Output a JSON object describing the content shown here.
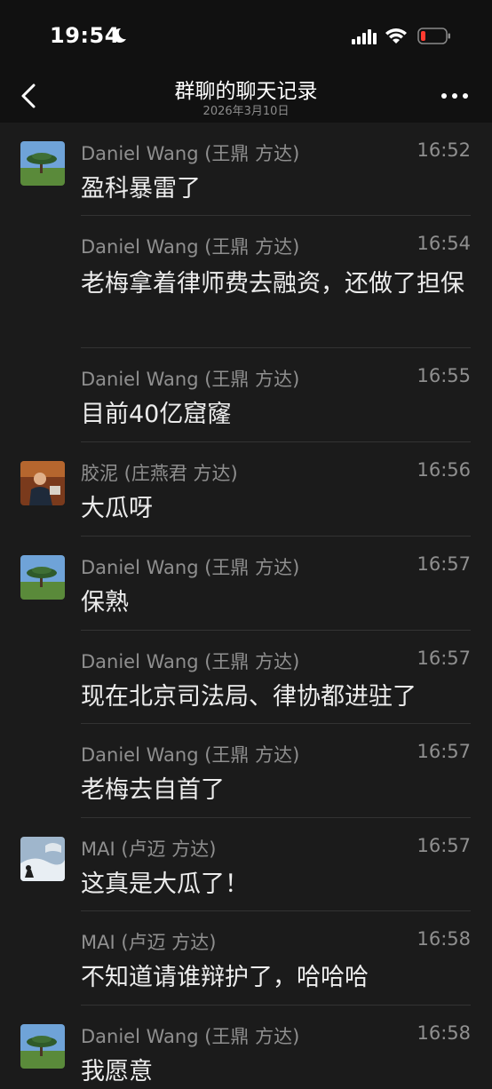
{
  "status": {
    "time": "19:54"
  },
  "nav": {
    "title": "群聊的聊天记录",
    "subtitle": "2026年3月10日"
  },
  "messages": [
    {
      "sender": "Daniel Wang (王鼎 方达)",
      "time": "16:52",
      "text": "盈科暴雷了",
      "avatar": "tree-avatar"
    },
    {
      "sender": "Daniel Wang (王鼎 方达)",
      "time": "16:54",
      "text": "老梅拿着律师费去融资，还做了担保",
      "avatar": ""
    },
    {
      "sender": "Daniel Wang (王鼎 方达)",
      "time": "16:55",
      "text": "目前40亿窟窿",
      "avatar": ""
    },
    {
      "sender": "胶泥 (庄燕君 方达)",
      "time": "16:56",
      "text": "大瓜呀",
      "avatar": "person-avatar"
    },
    {
      "sender": "Daniel Wang (王鼎 方达)",
      "time": "16:57",
      "text": "保熟",
      "avatar": "tree-avatar"
    },
    {
      "sender": "Daniel Wang (王鼎 方达)",
      "time": "16:57",
      "text": "现在北京司法局、律协都进驻了",
      "avatar": ""
    },
    {
      "sender": "Daniel Wang (王鼎 方达)",
      "time": "16:57",
      "text": "老梅去自首了",
      "avatar": ""
    },
    {
      "sender": "MAI (卢迈 方达)",
      "time": "16:57",
      "text": "这真是大瓜了！",
      "avatar": "snow-avatar"
    },
    {
      "sender": "MAI (卢迈 方达)",
      "time": "16:58",
      "text": "不知道请谁辩护了，哈哈哈",
      "avatar": ""
    },
    {
      "sender": "Daniel Wang (王鼎 方达)",
      "time": "16:58",
      "text": "我愿意",
      "avatar": "tree-avatar"
    }
  ]
}
